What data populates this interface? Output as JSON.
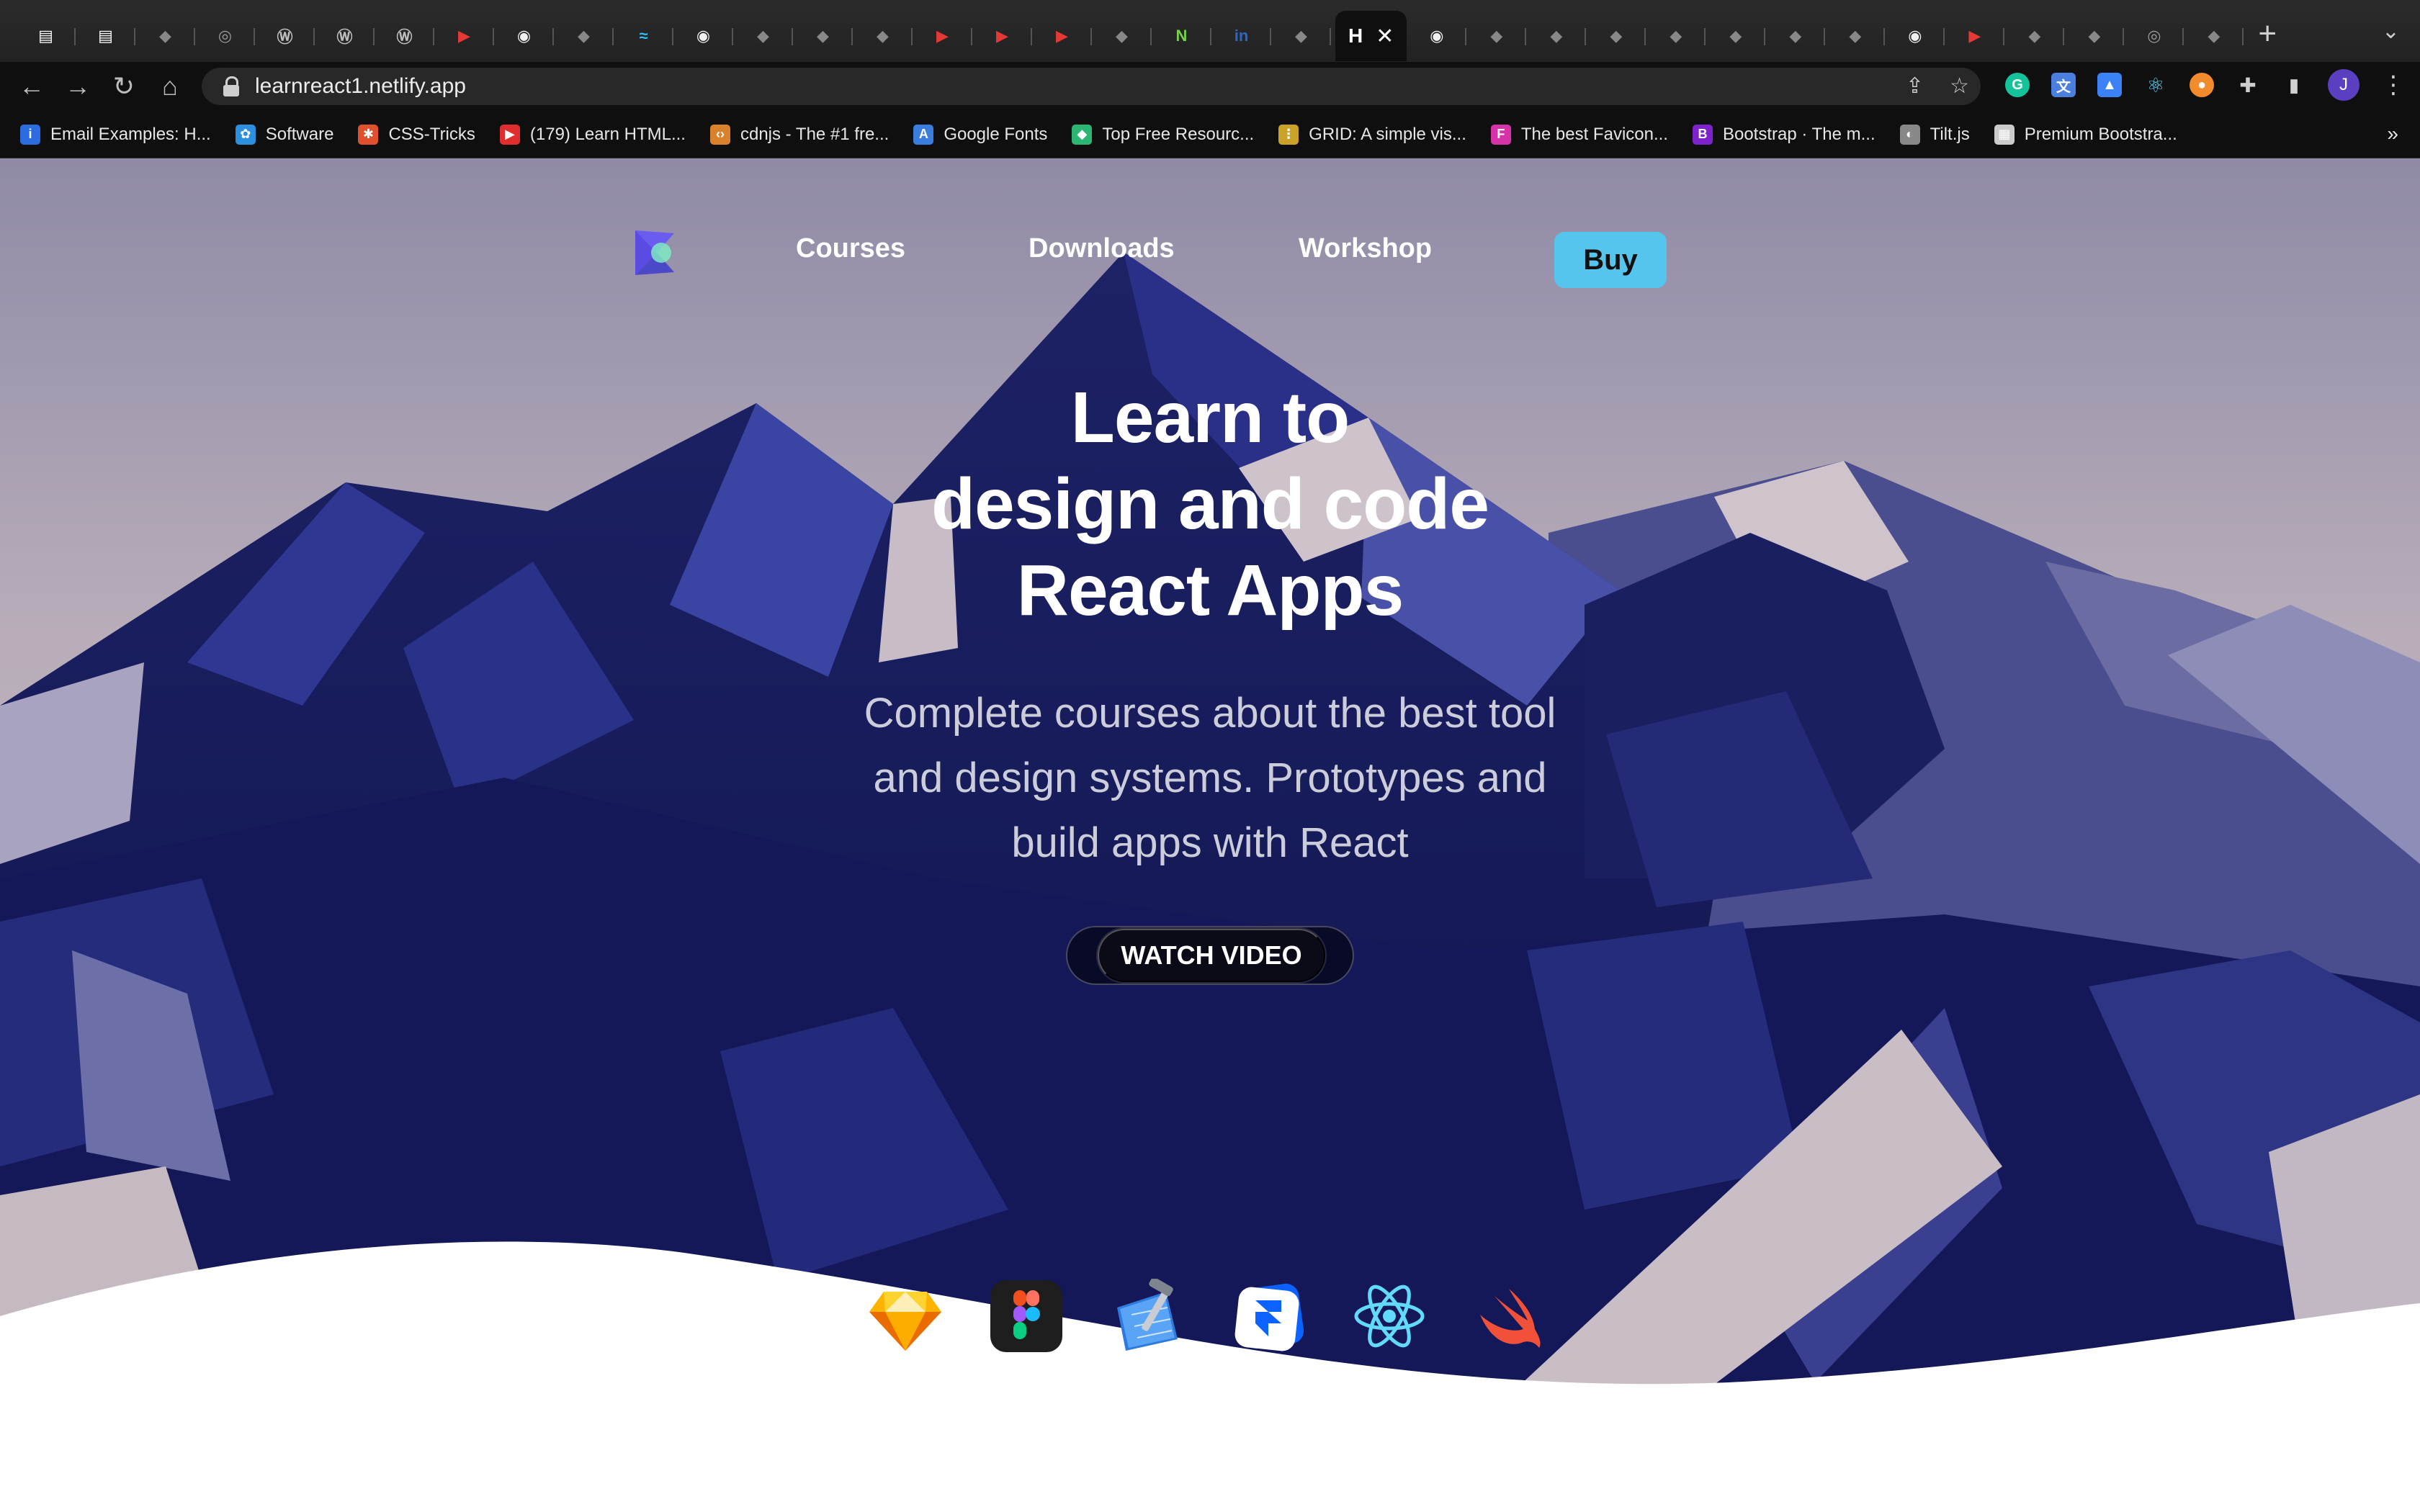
{
  "browser": {
    "url": "learnreact1.netlify.app",
    "active_tab_label": "H",
    "tabs": [
      "doc-icon",
      "doc-icon",
      "tab-icon",
      "globe-icon",
      "wordpress-icon",
      "wordpress-icon",
      "wordpress-icon",
      "youtube-icon",
      "github-icon",
      "tab-icon",
      "tailwind-icon",
      "github-icon",
      "tab-icon",
      "tab-icon",
      "tab-icon",
      "youtube-icon",
      "youtube-icon",
      "youtube-icon",
      "tab-icon",
      "nodemon-icon",
      "linkedin-icon",
      "tab-icon"
    ],
    "tabs_after": [
      "github-icon",
      "tab-icon",
      "tab-icon",
      "tab-icon",
      "tab-icon",
      "tab-icon",
      "tab-icon",
      "tab-icon",
      "github-icon",
      "youtube-icon",
      "tab-icon",
      "tab-icon",
      "globe-icon",
      "tab-icon"
    ],
    "avatar_letter": "J"
  },
  "bookmarks": [
    {
      "label": "Email Examples: H...",
      "color": "#2d6cdf",
      "glyph": "i"
    },
    {
      "label": "Software",
      "color": "#2d8fe0",
      "glyph": "✿"
    },
    {
      "label": "CSS-Tricks",
      "color": "#e0502d",
      "glyph": "✱"
    },
    {
      "label": "(179) Learn HTML...",
      "color": "#e02d2d",
      "glyph": "▶"
    },
    {
      "label": "cdnjs - The #1 fre...",
      "color": "#d9822b",
      "glyph": "‹›"
    },
    {
      "label": "Google Fonts",
      "color": "#3b7ddd",
      "glyph": "A"
    },
    {
      "label": "Top Free Resourc...",
      "color": "#2bb673",
      "glyph": "◆"
    },
    {
      "label": "GRID: A simple vis...",
      "color": "#c9a227",
      "glyph": "⋮"
    },
    {
      "label": "The best Favicon...",
      "color": "#d633a8",
      "glyph": "F"
    },
    {
      "label": "Bootstrap · The m...",
      "color": "#7e22ce",
      "glyph": "B"
    },
    {
      "label": "Tilt.js",
      "color": "#888888",
      "glyph": "◐"
    },
    {
      "label": "Premium Bootstra...",
      "color": "#cccccc",
      "glyph": "▦"
    }
  ],
  "nav": {
    "links": [
      "Courses",
      "Downloads",
      "Workshop"
    ],
    "buy_label": "Buy"
  },
  "hero": {
    "title_lines": [
      "Learn to",
      "design and code",
      "React Apps"
    ],
    "subtitle_lines": [
      "Complete courses about the best tool",
      "and design systems. Prototypes and",
      "build apps with React"
    ],
    "cta_label": "WATCH VIDEO"
  },
  "tools": [
    "sketch-icon",
    "figma-icon",
    "xcode-icon",
    "framer-icon",
    "react-icon",
    "swift-icon"
  ],
  "colors": {
    "buy_button": "#56c5ee",
    "mountain_dark": "#15195a",
    "mountain_mid": "#2d3590",
    "sky": "#b9aeb8"
  }
}
